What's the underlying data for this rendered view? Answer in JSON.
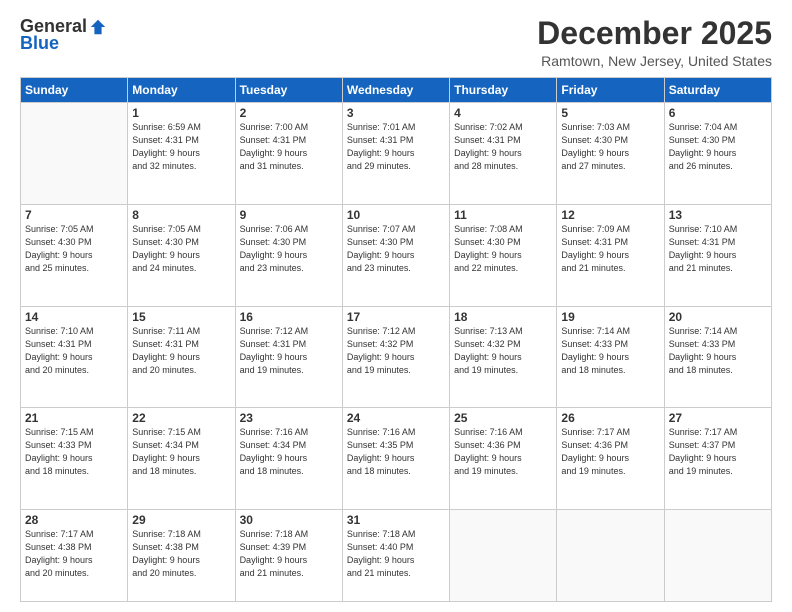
{
  "logo": {
    "general": "General",
    "blue": "Blue"
  },
  "header": {
    "month": "December 2025",
    "location": "Ramtown, New Jersey, United States"
  },
  "days_of_week": [
    "Sunday",
    "Monday",
    "Tuesday",
    "Wednesday",
    "Thursday",
    "Friday",
    "Saturday"
  ],
  "weeks": [
    [
      {
        "num": "",
        "detail": ""
      },
      {
        "num": "1",
        "detail": "Sunrise: 6:59 AM\nSunset: 4:31 PM\nDaylight: 9 hours\nand 32 minutes."
      },
      {
        "num": "2",
        "detail": "Sunrise: 7:00 AM\nSunset: 4:31 PM\nDaylight: 9 hours\nand 31 minutes."
      },
      {
        "num": "3",
        "detail": "Sunrise: 7:01 AM\nSunset: 4:31 PM\nDaylight: 9 hours\nand 29 minutes."
      },
      {
        "num": "4",
        "detail": "Sunrise: 7:02 AM\nSunset: 4:31 PM\nDaylight: 9 hours\nand 28 minutes."
      },
      {
        "num": "5",
        "detail": "Sunrise: 7:03 AM\nSunset: 4:30 PM\nDaylight: 9 hours\nand 27 minutes."
      },
      {
        "num": "6",
        "detail": "Sunrise: 7:04 AM\nSunset: 4:30 PM\nDaylight: 9 hours\nand 26 minutes."
      }
    ],
    [
      {
        "num": "7",
        "detail": "Sunrise: 7:05 AM\nSunset: 4:30 PM\nDaylight: 9 hours\nand 25 minutes."
      },
      {
        "num": "8",
        "detail": "Sunrise: 7:05 AM\nSunset: 4:30 PM\nDaylight: 9 hours\nand 24 minutes."
      },
      {
        "num": "9",
        "detail": "Sunrise: 7:06 AM\nSunset: 4:30 PM\nDaylight: 9 hours\nand 23 minutes."
      },
      {
        "num": "10",
        "detail": "Sunrise: 7:07 AM\nSunset: 4:30 PM\nDaylight: 9 hours\nand 23 minutes."
      },
      {
        "num": "11",
        "detail": "Sunrise: 7:08 AM\nSunset: 4:30 PM\nDaylight: 9 hours\nand 22 minutes."
      },
      {
        "num": "12",
        "detail": "Sunrise: 7:09 AM\nSunset: 4:31 PM\nDaylight: 9 hours\nand 21 minutes."
      },
      {
        "num": "13",
        "detail": "Sunrise: 7:10 AM\nSunset: 4:31 PM\nDaylight: 9 hours\nand 21 minutes."
      }
    ],
    [
      {
        "num": "14",
        "detail": "Sunrise: 7:10 AM\nSunset: 4:31 PM\nDaylight: 9 hours\nand 20 minutes."
      },
      {
        "num": "15",
        "detail": "Sunrise: 7:11 AM\nSunset: 4:31 PM\nDaylight: 9 hours\nand 20 minutes."
      },
      {
        "num": "16",
        "detail": "Sunrise: 7:12 AM\nSunset: 4:31 PM\nDaylight: 9 hours\nand 19 minutes."
      },
      {
        "num": "17",
        "detail": "Sunrise: 7:12 AM\nSunset: 4:32 PM\nDaylight: 9 hours\nand 19 minutes."
      },
      {
        "num": "18",
        "detail": "Sunrise: 7:13 AM\nSunset: 4:32 PM\nDaylight: 9 hours\nand 19 minutes."
      },
      {
        "num": "19",
        "detail": "Sunrise: 7:14 AM\nSunset: 4:33 PM\nDaylight: 9 hours\nand 18 minutes."
      },
      {
        "num": "20",
        "detail": "Sunrise: 7:14 AM\nSunset: 4:33 PM\nDaylight: 9 hours\nand 18 minutes."
      }
    ],
    [
      {
        "num": "21",
        "detail": "Sunrise: 7:15 AM\nSunset: 4:33 PM\nDaylight: 9 hours\nand 18 minutes."
      },
      {
        "num": "22",
        "detail": "Sunrise: 7:15 AM\nSunset: 4:34 PM\nDaylight: 9 hours\nand 18 minutes."
      },
      {
        "num": "23",
        "detail": "Sunrise: 7:16 AM\nSunset: 4:34 PM\nDaylight: 9 hours\nand 18 minutes."
      },
      {
        "num": "24",
        "detail": "Sunrise: 7:16 AM\nSunset: 4:35 PM\nDaylight: 9 hours\nand 18 minutes."
      },
      {
        "num": "25",
        "detail": "Sunrise: 7:16 AM\nSunset: 4:36 PM\nDaylight: 9 hours\nand 19 minutes."
      },
      {
        "num": "26",
        "detail": "Sunrise: 7:17 AM\nSunset: 4:36 PM\nDaylight: 9 hours\nand 19 minutes."
      },
      {
        "num": "27",
        "detail": "Sunrise: 7:17 AM\nSunset: 4:37 PM\nDaylight: 9 hours\nand 19 minutes."
      }
    ],
    [
      {
        "num": "28",
        "detail": "Sunrise: 7:17 AM\nSunset: 4:38 PM\nDaylight: 9 hours\nand 20 minutes."
      },
      {
        "num": "29",
        "detail": "Sunrise: 7:18 AM\nSunset: 4:38 PM\nDaylight: 9 hours\nand 20 minutes."
      },
      {
        "num": "30",
        "detail": "Sunrise: 7:18 AM\nSunset: 4:39 PM\nDaylight: 9 hours\nand 21 minutes."
      },
      {
        "num": "31",
        "detail": "Sunrise: 7:18 AM\nSunset: 4:40 PM\nDaylight: 9 hours\nand 21 minutes."
      },
      {
        "num": "",
        "detail": ""
      },
      {
        "num": "",
        "detail": ""
      },
      {
        "num": "",
        "detail": ""
      }
    ]
  ]
}
